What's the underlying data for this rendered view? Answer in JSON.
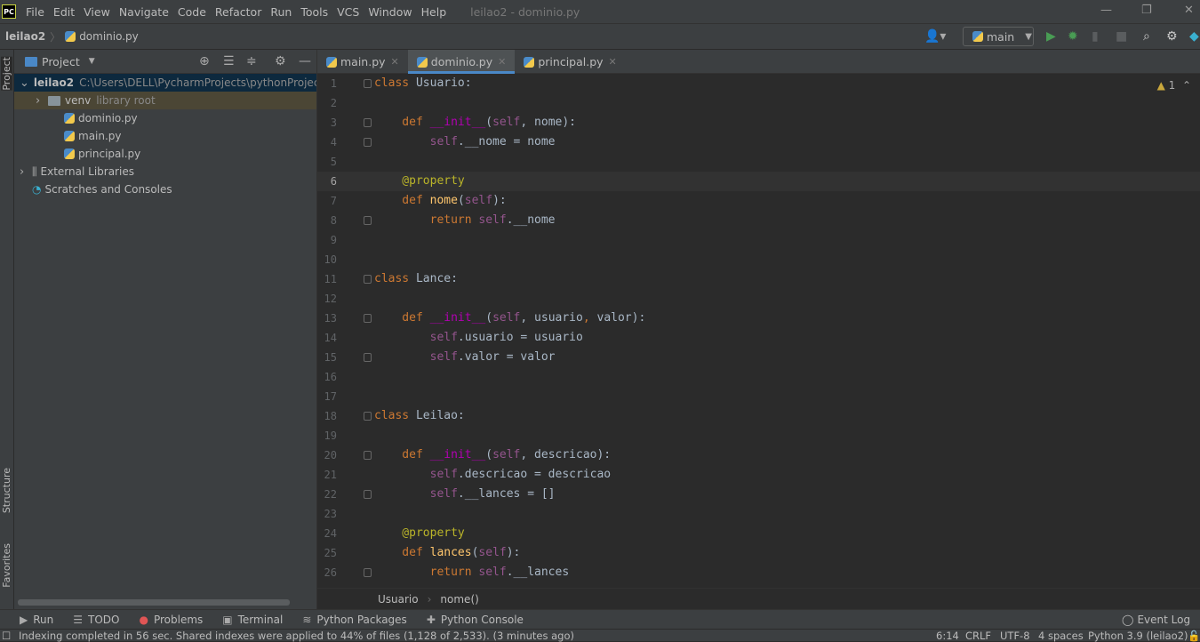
{
  "app": {
    "logo": "PC",
    "window_title": "leilao2 - dominio.py"
  },
  "menu": [
    "File",
    "Edit",
    "View",
    "Navigate",
    "Code",
    "Refactor",
    "Run",
    "Tools",
    "VCS",
    "Window",
    "Help"
  ],
  "nav": {
    "project": "leilao2",
    "file": "dominio.py",
    "run_config": "main"
  },
  "side": {
    "project_tab": "Project",
    "structure_tab": "Structure",
    "favorites_tab": "Favorites"
  },
  "project": {
    "title": "Project",
    "tree": [
      {
        "label": "leilao2",
        "extra": "C:\\Users\\DELL\\PycharmProjects\\pythonProject\\l",
        "type": "folder",
        "depth": 0,
        "expanded": true
      },
      {
        "label": "venv",
        "extra": "library root",
        "type": "folder",
        "depth": 1,
        "expanded": false
      },
      {
        "label": "dominio.py",
        "extra": "",
        "type": "py",
        "depth": 2
      },
      {
        "label": "main.py",
        "extra": "",
        "type": "py",
        "depth": 2
      },
      {
        "label": "principal.py",
        "extra": "",
        "type": "py",
        "depth": 2
      },
      {
        "label": "External Libraries",
        "extra": "",
        "type": "lib",
        "depth": 0,
        "expanded": false
      },
      {
        "label": "Scratches and Consoles",
        "extra": "",
        "type": "scratch",
        "depth": 0
      }
    ]
  },
  "tabs": [
    {
      "label": "main.py",
      "active": false
    },
    {
      "label": "dominio.py",
      "active": true
    },
    {
      "label": "principal.py",
      "active": false
    }
  ],
  "editor": {
    "warnings": "1",
    "current_line": 6,
    "lines": [
      [
        [
          "class ",
          "kw"
        ],
        [
          "Usuario:",
          "pl"
        ]
      ],
      [],
      [
        [
          "    def ",
          "kw"
        ],
        [
          "__init__",
          "dun"
        ],
        [
          "(",
          "pl"
        ],
        [
          "self",
          "self"
        ],
        [
          ", nome):",
          "pl"
        ]
      ],
      [
        [
          "        self",
          "self"
        ],
        [
          ".__nome = nome",
          "pl"
        ]
      ],
      [],
      [
        [
          "    @property",
          "dec"
        ]
      ],
      [
        [
          "    def ",
          "kw"
        ],
        [
          "nome",
          "fn"
        ],
        [
          "(",
          "pl"
        ],
        [
          "self",
          "self"
        ],
        [
          "):",
          "pl"
        ]
      ],
      [
        [
          "        return ",
          "kw"
        ],
        [
          "self",
          "self"
        ],
        [
          ".__nome",
          "pl"
        ]
      ],
      [],
      [],
      [
        [
          "class ",
          "kw"
        ],
        [
          "Lance:",
          "pl"
        ]
      ],
      [],
      [
        [
          "    def ",
          "kw"
        ],
        [
          "__init__",
          "dun"
        ],
        [
          "(",
          "pl"
        ],
        [
          "self",
          "self"
        ],
        [
          ", usuario",
          "pl"
        ],
        [
          ", ",
          "kw"
        ],
        [
          "valor):",
          "pl"
        ]
      ],
      [
        [
          "        self",
          "self"
        ],
        [
          ".usuario = usuario",
          "pl"
        ]
      ],
      [
        [
          "        self",
          "self"
        ],
        [
          ".valor = valor",
          "pl"
        ]
      ],
      [],
      [],
      [
        [
          "class ",
          "kw"
        ],
        [
          "Leilao:",
          "pl"
        ]
      ],
      [],
      [
        [
          "    def ",
          "kw"
        ],
        [
          "__init__",
          "dun"
        ],
        [
          "(",
          "pl"
        ],
        [
          "self",
          "self"
        ],
        [
          ", descricao):",
          "pl"
        ]
      ],
      [
        [
          "        self",
          "self"
        ],
        [
          ".descricao = descricao",
          "pl"
        ]
      ],
      [
        [
          "        self",
          "self"
        ],
        [
          ".__lances = []",
          "pl"
        ]
      ],
      [],
      [
        [
          "    @property",
          "dec"
        ]
      ],
      [
        [
          "    def ",
          "kw"
        ],
        [
          "lances",
          "fn"
        ],
        [
          "(",
          "pl"
        ],
        [
          "self",
          "self"
        ],
        [
          "):",
          "pl"
        ]
      ],
      [
        [
          "        return ",
          "kw"
        ],
        [
          "self",
          "self"
        ],
        [
          ".__lances",
          "pl"
        ]
      ]
    ]
  },
  "breadcrumb": [
    "Usuario",
    "nome()"
  ],
  "toolwindows": [
    {
      "icon": "run",
      "label": "Run"
    },
    {
      "icon": "todo",
      "label": "TODO"
    },
    {
      "icon": "problems",
      "label": "Problems"
    },
    {
      "icon": "terminal",
      "label": "Terminal"
    },
    {
      "icon": "packages",
      "label": "Python Packages"
    },
    {
      "icon": "console",
      "label": "Python Console"
    }
  ],
  "event_log": "Event Log",
  "status": {
    "message": "Indexing completed in 56 sec. Shared indexes were applied to 44% of files (1,128 of 2,533). (3 minutes ago)",
    "position": "6:14",
    "line_sep": "CRLF",
    "encoding": "UTF-8",
    "indent": "4 spaces",
    "interpreter": "Python 3.9 (leilao2)"
  }
}
